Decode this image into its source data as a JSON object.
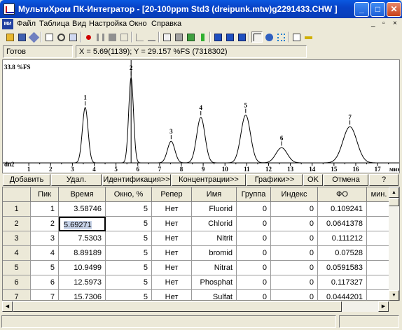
{
  "window": {
    "title": "МультиХром ПК-Интегратор - [20-100ppm Std3 (dreipunk.mtw)g2291433.CHW ]",
    "minimize": "_",
    "maximize": "□",
    "close": "✕"
  },
  "menu": {
    "icon_text": "МИ",
    "items": [
      "Файл",
      "Таблица",
      "Вид",
      "Настройка",
      "Окно",
      "Справка"
    ],
    "mdi_controls": [
      "_",
      "▫",
      "×"
    ]
  },
  "toolbar": {
    "icons": [
      "open-icon",
      "save-icon",
      "method-icon",
      "print-preview-icon",
      "search-icon",
      "export-icon",
      "record-icon",
      "pause-icon",
      "stop-icon",
      "calibration-icon",
      "graph-icon",
      "baseline-icon",
      "peaks-icon",
      "calc-icon",
      "check-icon",
      "filter-icon",
      "window-tile-icon",
      "window-cascade-icon",
      "window-split-icon",
      "cursor-icon",
      "zoom-icon",
      "settings-icon",
      "key-icon"
    ]
  },
  "status": {
    "state": "Готов",
    "cursor": "X = 5.69(1139); Y = 29.157 %FS (7318302)"
  },
  "chart_data": {
    "type": "line",
    "y_label": "33.8 %FS",
    "channel": "dn2",
    "x_unit": "мин",
    "xlim": [
      0,
      17.8
    ],
    "ylim": [
      0,
      33.8
    ],
    "x_ticks": [
      "1",
      "2",
      "3",
      "4",
      "5",
      "6",
      "7",
      "8",
      "9",
      "10",
      "11",
      "12",
      "13",
      "14",
      "15",
      "16",
      "17"
    ],
    "peaks": [
      {
        "label": "1",
        "rt": 3.58746,
        "height": 19.0,
        "width": 0.13
      },
      {
        "label": "2",
        "rt": 5.69271,
        "height": 29.2,
        "width": 0.11
      },
      {
        "label": "3",
        "rt": 7.5303,
        "height": 7.4,
        "width": 0.17
      },
      {
        "label": "4",
        "rt": 8.89189,
        "height": 15.6,
        "width": 0.19
      },
      {
        "label": "5",
        "rt": 10.9499,
        "height": 16.4,
        "width": 0.22
      },
      {
        "label": "6",
        "rt": 12.5973,
        "height": 5.2,
        "width": 0.26
      },
      {
        "label": "7",
        "rt": 15.7306,
        "height": 12.4,
        "width": 0.32
      }
    ]
  },
  "buttons": [
    "Добавить",
    "Удал.",
    "Идентификация>>",
    "Концентрации>>",
    "Графики>>",
    "OK",
    "Отмена",
    "?"
  ],
  "table": {
    "columns": [
      "Пик",
      "Время",
      "Окно, %",
      "Репер",
      "Имя",
      "Группа",
      "Индекс",
      "ФО",
      "мин."
    ],
    "rows": [
      {
        "n": "1",
        "peak": "1",
        "time": "3.58746",
        "window": "5",
        "ref": "Нет",
        "name": "Fluorid",
        "group": "0",
        "index": "0",
        "fo": "0.109241"
      },
      {
        "n": "2",
        "peak": "2",
        "time": "5.69271",
        "window": "5",
        "ref": "Нет",
        "name": "Chlorid",
        "group": "0",
        "index": "0",
        "fo": "0.0641378"
      },
      {
        "n": "3",
        "peak": "3",
        "time": "7.5303",
        "window": "5",
        "ref": "Нет",
        "name": "Nitrit",
        "group": "0",
        "index": "0",
        "fo": "0.111212"
      },
      {
        "n": "4",
        "peak": "4",
        "time": "8.89189",
        "window": "5",
        "ref": "Нет",
        "name": "bromid",
        "group": "0",
        "index": "0",
        "fo": "0.07528"
      },
      {
        "n": "5",
        "peak": "5",
        "time": "10.9499",
        "window": "5",
        "ref": "Нет",
        "name": "Nitrat",
        "group": "0",
        "index": "0",
        "fo": "0.0591583"
      },
      {
        "n": "6",
        "peak": "6",
        "time": "12.5973",
        "window": "5",
        "ref": "Нет",
        "name": "Phosphat",
        "group": "0",
        "index": "0",
        "fo": "0.117327"
      },
      {
        "n": "7",
        "peak": "7",
        "time": "15.7306",
        "window": "5",
        "ref": "Нет",
        "name": "Sulfat",
        "group": "0",
        "index": "0",
        "fo": "0.0444201"
      }
    ]
  }
}
